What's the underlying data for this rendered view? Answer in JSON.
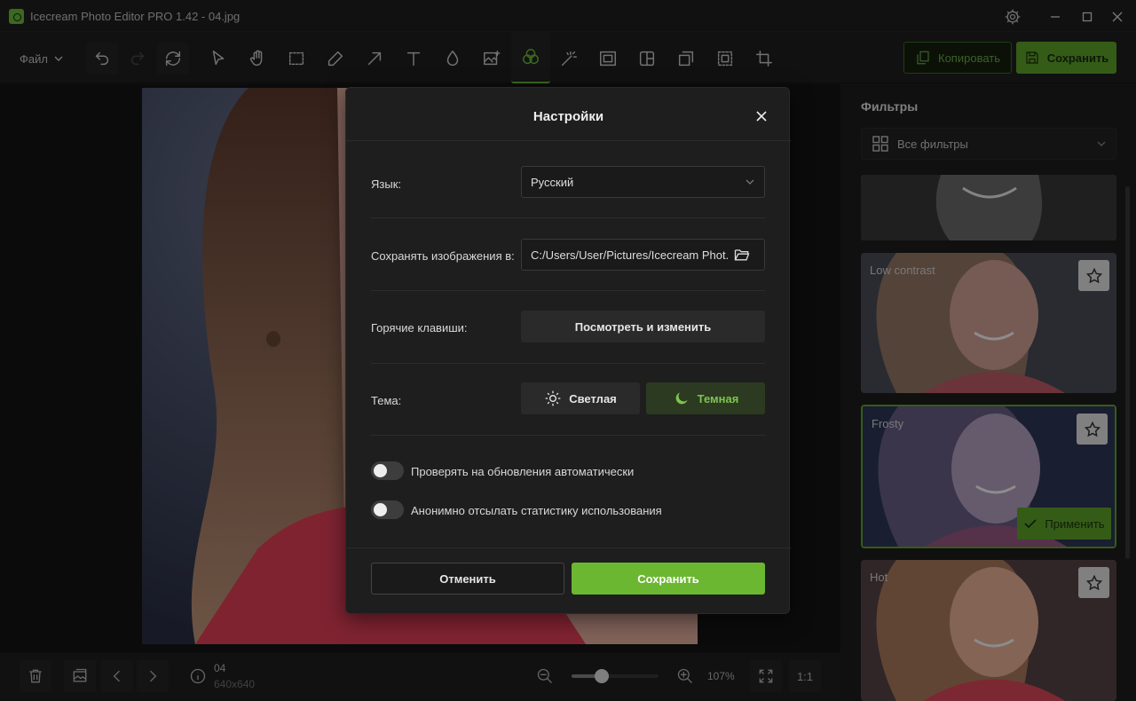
{
  "window": {
    "title": "Icecream Photo Editor PRO 1.42 - 04.jpg"
  },
  "toolbar": {
    "file_label": "Файл",
    "copy_label": "Копировать",
    "save_label": "Сохранить"
  },
  "filters_panel": {
    "title": "Фильтры",
    "dropdown_label": "Все фильтры",
    "cards": [
      {
        "name": ""
      },
      {
        "name": "Low contrast"
      },
      {
        "name": "Frosty",
        "selected": true,
        "apply_label": "Применить"
      },
      {
        "name": "Hot"
      }
    ]
  },
  "bottom": {
    "file_name": "04",
    "dimensions": "640x640",
    "zoom": "107%",
    "ratio_label": "1:1",
    "zoom_level": 0.35
  },
  "settings_dialog": {
    "title": "Настройки",
    "language_label": "Язык:",
    "language_value": "Русский",
    "save_path_label": "Сохранять изображения в:",
    "save_path_value": "C:/Users/User/Pictures/Icecream Phot...",
    "hotkeys_label": "Горячие клавиши:",
    "hotkeys_button": "Посмотреть и изменить",
    "theme_label": "Тема:",
    "theme_light": "Светлая",
    "theme_dark": "Темная",
    "auto_update_label": "Проверять на обновления автоматически",
    "auto_update_on": false,
    "stats_label": "Анонимно отсылать статистику использования",
    "stats_on": false,
    "cancel_label": "Отменить",
    "save_label": "Сохранить"
  },
  "colors": {
    "accent": "#6cbf3a",
    "background": "#1c1c1c",
    "panel": "#1e1e1e"
  },
  "icons": [
    "app-icon",
    "gear-icon",
    "minimize-icon",
    "maximize-icon",
    "close-icon",
    "undo-icon",
    "redo-icon",
    "reset-icon",
    "select-icon",
    "hand-icon",
    "marquee-icon",
    "pencil-icon",
    "arrow-icon",
    "text-icon",
    "drop-icon",
    "image-icon",
    "filters-icon",
    "magic-icon",
    "frame-icon",
    "collage-icon",
    "resize-icon",
    "crop-select-icon",
    "crop-icon",
    "copy-icon",
    "save-icon",
    "grid-icon",
    "star-icon",
    "check-icon",
    "trash-icon",
    "gallery-icon",
    "prev-icon",
    "next-icon",
    "info-icon",
    "zoom-out-icon",
    "zoom-in-icon",
    "fit-icon",
    "folder-icon",
    "sun-icon",
    "moon-icon"
  ]
}
